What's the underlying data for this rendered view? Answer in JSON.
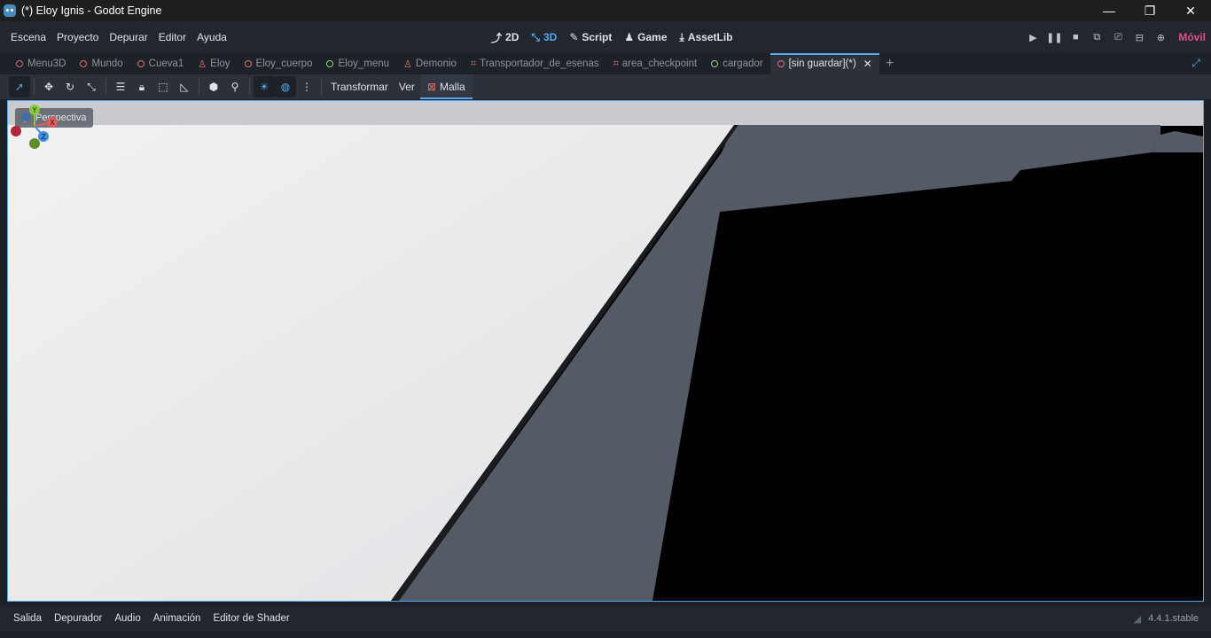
{
  "window": {
    "title": "(*) Eloy Ignis - Godot Engine",
    "controls": {
      "minimize": "—",
      "maximize": "❐",
      "close": "✕"
    }
  },
  "menus": [
    "Escena",
    "Proyecto",
    "Depurar",
    "Editor",
    "Ayuda"
  ],
  "workspaces": [
    {
      "label": "2D",
      "icon": "2d-icon",
      "active": false
    },
    {
      "label": "3D",
      "icon": "3d-icon",
      "active": true
    },
    {
      "label": "Script",
      "icon": "script-icon",
      "active": false
    },
    {
      "label": "Game",
      "icon": "game-icon",
      "active": false
    },
    {
      "label": "AssetLib",
      "icon": "assetlib-icon",
      "active": false
    }
  ],
  "run_controls": {
    "renderer": "Móvil",
    "buttons": [
      "play-icon",
      "pause-icon",
      "stop-icon",
      "remote-debug-icon",
      "play-scene-icon",
      "play-custom-icon",
      "movie-maker-icon"
    ]
  },
  "scene_tabs": [
    {
      "label": "Menu3D",
      "icon": "node-circle-red"
    },
    {
      "label": "Mundo",
      "icon": "node-circle-red"
    },
    {
      "label": "Cueva1",
      "icon": "node-circle-red"
    },
    {
      "label": "Eloy",
      "icon": "character-icon"
    },
    {
      "label": "Eloy_cuerpo",
      "icon": "node-circle-red"
    },
    {
      "label": "Eloy_menu",
      "icon": "control-circle-green"
    },
    {
      "label": "Demonio",
      "icon": "character-icon"
    },
    {
      "label": "Transportador_de_esenas",
      "icon": "area-icon"
    },
    {
      "label": "area_checkpoint",
      "icon": "area-icon"
    },
    {
      "label": "cargador",
      "icon": "control-circle-green"
    },
    {
      "label": "[sin guardar](*)",
      "icon": "node-circle-red",
      "active": true
    }
  ],
  "toolbar3d": {
    "transform_label": "Transformar",
    "view_label": "Ver",
    "mesh_label": "Malla"
  },
  "viewport": {
    "perspective_label": "Perspectiva",
    "gizmo": {
      "x": "X",
      "y": "Y",
      "z": "Z"
    },
    "colors": {
      "light_face": "#e6e7e9",
      "slope_face": "#555b66",
      "background": "#000000",
      "horizon": "#c9cacd"
    }
  },
  "bottom_panel": {
    "tabs": [
      "Salida",
      "Depurador",
      "Audio",
      "Animación",
      "Editor de Shader"
    ],
    "version": "4.4.1.stable"
  },
  "colors": {
    "accent": "#56a6ec",
    "renderer": "#e0508f",
    "error": "#e26d6d"
  }
}
